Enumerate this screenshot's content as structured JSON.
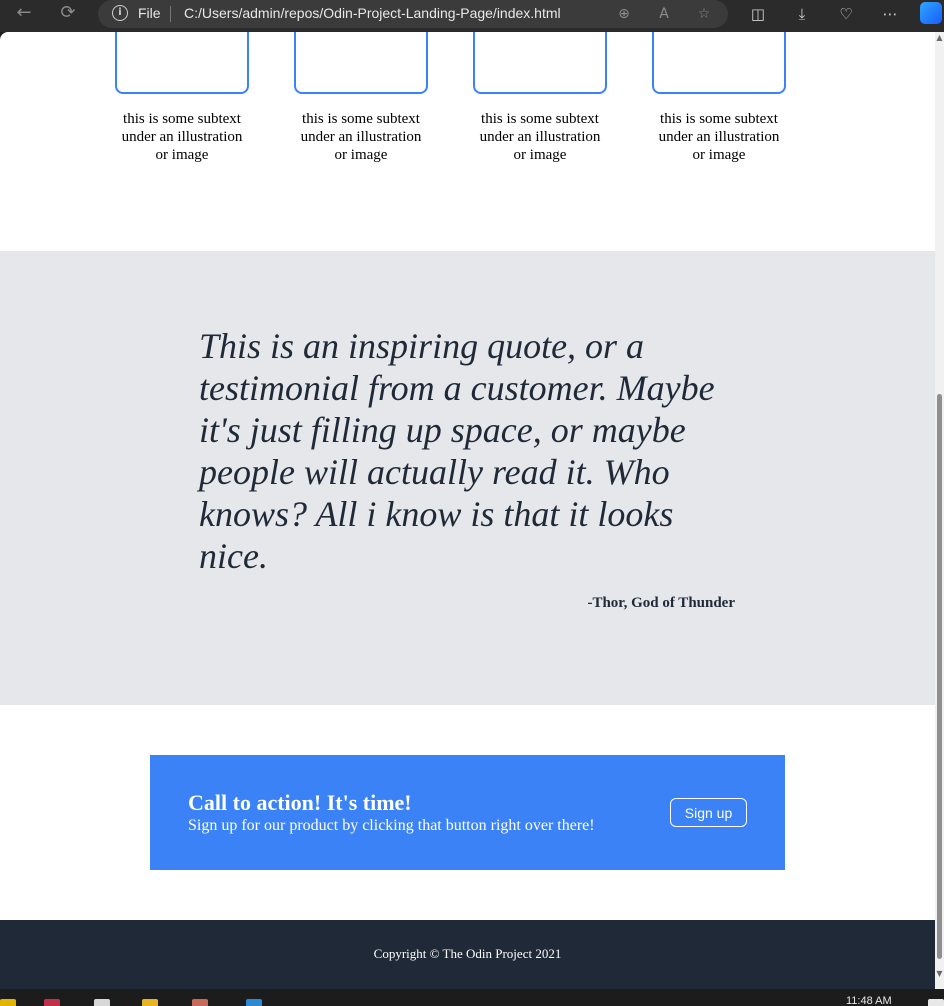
{
  "browser": {
    "file_label": "File",
    "url": "C:/Users/admin/repos/Odin-Project-Landing-Page/index.html"
  },
  "cards": [
    {
      "text": "this is some subtext under an illustration or image"
    },
    {
      "text": "this is some subtext under an illustration or image"
    },
    {
      "text": "this is some subtext under an illustration or image"
    },
    {
      "text": "this is some subtext under an illustration or image"
    }
  ],
  "quote": {
    "text": "This is an inspiring quote, or a testimonial from a customer. Maybe it's just filling up space, or maybe people will actually read it. Who knows? All i know is that it looks nice.",
    "author": "-Thor, God of Thunder"
  },
  "cta": {
    "title": "Call to action! It's time!",
    "subtitle": "Sign up for our product by clicking that button right over there!",
    "button_label": "Sign up"
  },
  "footer": {
    "copyright": "Copyright © The Odin Project 2021"
  },
  "taskbar": {
    "clock": "11:48 AM"
  },
  "colors": {
    "accent": "#3b82f6",
    "quote_bg": "#e5e7eb",
    "footer_bg": "#1f2937"
  }
}
